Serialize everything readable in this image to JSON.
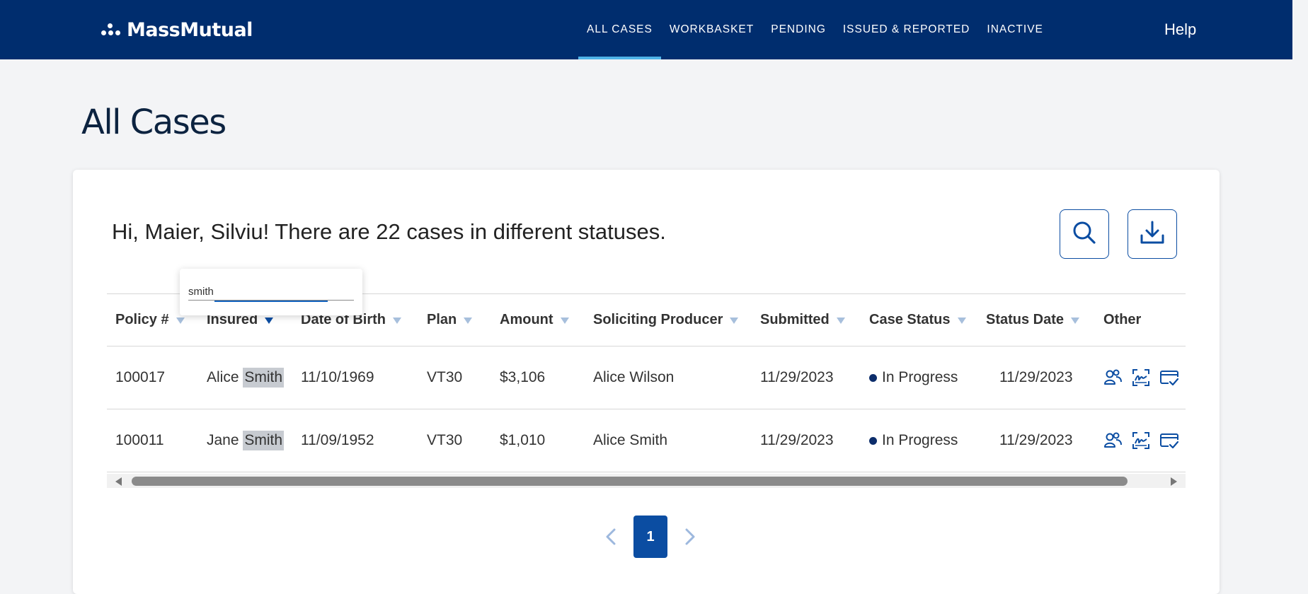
{
  "header": {
    "brand": "MassMutual",
    "nav": [
      {
        "label": "ALL CASES",
        "active": true
      },
      {
        "label": "WORKBASKET",
        "active": false
      },
      {
        "label": "PENDING",
        "active": false
      },
      {
        "label": "ISSUED & REPORTED",
        "active": false
      },
      {
        "label": "INACTIVE",
        "active": false
      }
    ],
    "help": "Help"
  },
  "page": {
    "title": "All Cases"
  },
  "greeting": {
    "prefix": "Hi, Maier, Silviu! There are ",
    "count": "22",
    "suffix": " cases in different statuses."
  },
  "table": {
    "columns": [
      "Policy #",
      "Insured",
      "Date of Birth",
      "Plan",
      "Amount",
      "Soliciting Producer",
      "Submitted",
      "Case Status",
      "Status Date",
      "Other"
    ],
    "rows": [
      {
        "policy": "100017",
        "insured_first": "Alice",
        "insured_last": "Smith",
        "dob": "11/10/1969",
        "plan": "VT30",
        "amount": "$3,106",
        "producer": "Alice Wilson",
        "submitted": "11/29/2023",
        "status": "In Progress",
        "status_date": "11/29/2023"
      },
      {
        "policy": "100011",
        "insured_first": "Jane",
        "insured_last": "Smith",
        "dob": "11/09/1952",
        "plan": "VT30",
        "amount": "$1,010",
        "producer": "Alice Smith",
        "submitted": "11/29/2023",
        "status": "In Progress",
        "status_date": "11/29/2023"
      }
    ]
  },
  "filter_popup": {
    "value": "smith"
  },
  "pagination": {
    "current": "1"
  },
  "colors": {
    "header_bg": "#002d6e",
    "accent": "#0b4da2",
    "active_tab": "#4fb3e8",
    "status_dot": "#0c2d6b"
  },
  "icons": [
    "search-icon",
    "download-icon",
    "people-icon",
    "signature-icon",
    "card-check-icon",
    "chevron-left-icon",
    "chevron-right-icon"
  ]
}
